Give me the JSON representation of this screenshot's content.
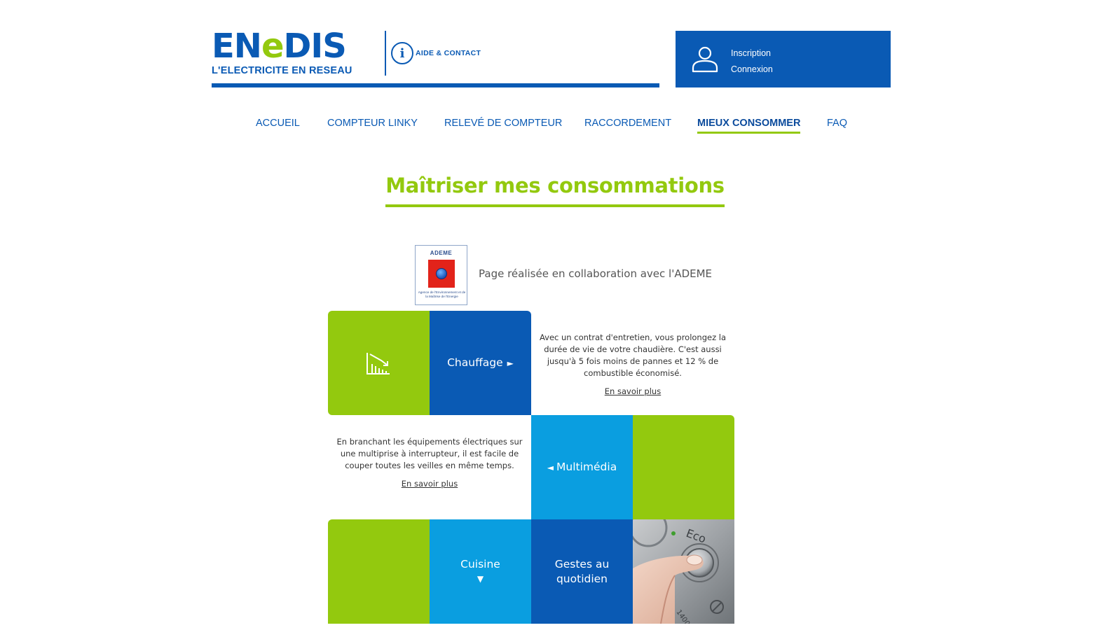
{
  "header": {
    "logo_text_part1": "EN",
    "logo_text_part2": "e",
    "logo_text_part3": "DIS",
    "logo_tagline": "L'ELECTRICITE EN RESEAU",
    "help_icon": "info-icon",
    "help_label": "AIDE & CONTACT",
    "account": {
      "icon": "user-icon",
      "inscription": "Inscription",
      "connexion": "Connexion"
    }
  },
  "nav": {
    "items": [
      {
        "label": "ACCUEIL"
      },
      {
        "label": "COMPTEUR LINKY"
      },
      {
        "label": "RELEVÉ DE COMPTEUR"
      },
      {
        "label": "RACCORDEMENT"
      },
      {
        "label": "MIEUX CONSOMMER",
        "active": true
      },
      {
        "label": "FAQ"
      }
    ]
  },
  "main": {
    "title": "Maîtriser mes consommations",
    "partner": {
      "logo_name": "ADEME",
      "logo_caption": "Agence de l'Environnement et de la Maîtrise de l'Energie",
      "text": "Page réalisée en collaboration avec l'ADEME"
    },
    "tiles": {
      "chauffage": {
        "icon": "chart-down-icon",
        "label": "Chauffage",
        "arrow": "►",
        "description": "Avec un contrat d'entretien, vous prolongez la durée de vie de votre chaudière. C'est aussi jusqu'à 5 fois moins de pannes et 12 % de combustible économisé.",
        "more": "En savoir plus"
      },
      "multimedia": {
        "label": "Multimédia",
        "arrow": "◄",
        "description": "En branchant les équipements électriques sur une multiprise à interrupteur, il est facile de couper toutes les veilles en même temps.",
        "more": "En savoir plus"
      },
      "cuisine": {
        "label": "Cuisine",
        "arrow": "▼"
      },
      "gestes": {
        "label_line1": "Gestes au",
        "label_line2": "quotidien"
      }
    },
    "photo_text": "Eco"
  },
  "colors": {
    "brand_blue": "#0a5ab4",
    "brand_green": "#93c90e",
    "cyan": "#0a9ee0"
  }
}
